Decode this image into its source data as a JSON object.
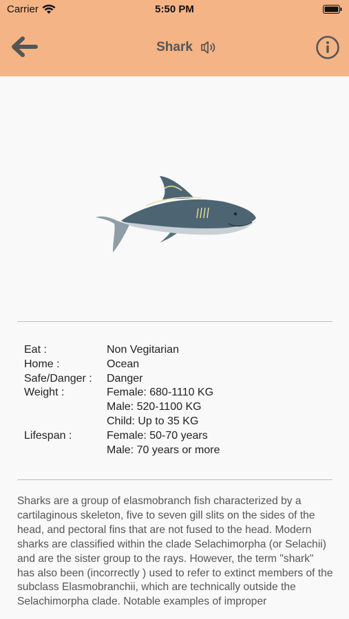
{
  "status_bar": {
    "carrier": "Carrier",
    "time": "5:50 PM"
  },
  "nav": {
    "title": "Shark",
    "back_icon": "back-arrow-icon",
    "speaker_icon": "speaker-icon",
    "info_icon": "info-icon"
  },
  "colors": {
    "nav_background": "#f4b486",
    "page_background": "#f9f9f9",
    "text": "#222222",
    "description_text": "#555555"
  },
  "facts": [
    {
      "label": "Eat :",
      "values": [
        "Non Vegitarian"
      ]
    },
    {
      "label": "Home :",
      "values": [
        "Ocean"
      ]
    },
    {
      "label": "Safe/Danger :",
      "values": [
        "Danger"
      ]
    },
    {
      "label": "Weight :",
      "values": [
        "Female: 680-1110 KG",
        "Male: 520-1100 KG",
        "Child: Up to 35 KG"
      ]
    },
    {
      "label": "Lifespan :",
      "values": [
        "Female: 50-70 years",
        "Male: 70 years or more"
      ]
    }
  ],
  "description": "Sharks are a group of elasmobranch fish characterized by a cartilaginous skeleton, five to seven gill slits on the sides of the head, and pectoral fins that are not fused to the head. Modern sharks are classified within the clade Selachimorpha (or Selachii) and are the sister group to the rays. However, the term \"shark\" has also been (incorrectly ) used to refer to extinct members of the subclass Elasmobranchii, which are technically outside the Selachimorpha clade. Notable examples of improper"
}
